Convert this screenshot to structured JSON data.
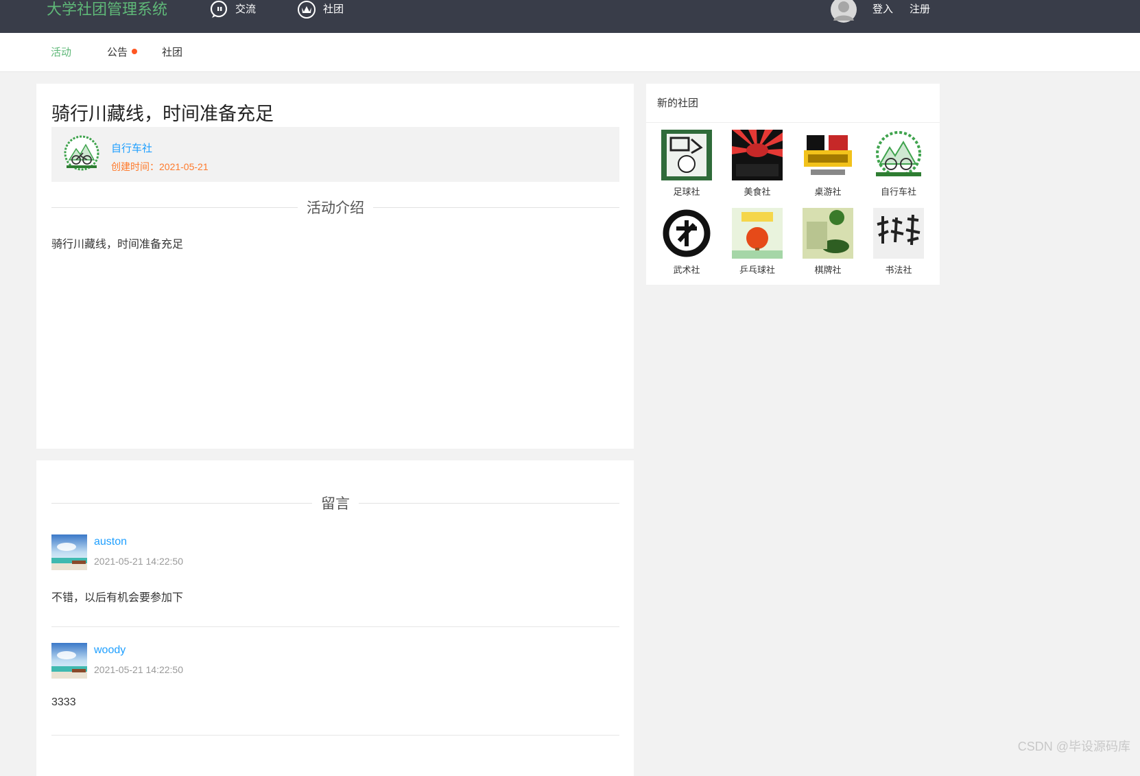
{
  "header": {
    "brand": "大学社团管理系统",
    "nav": [
      {
        "label": "交流",
        "icon": "chat-bubble-icon"
      },
      {
        "label": "社团",
        "icon": "crown-icon"
      }
    ],
    "login": "登入",
    "register": "注册"
  },
  "subnav": {
    "tabs": [
      {
        "label": "活动",
        "active": true
      },
      {
        "label": "公告",
        "has_dot": true
      },
      {
        "label": "社团"
      }
    ]
  },
  "activity": {
    "title": "骑行川藏线，时间准备充足",
    "club_name": "自行车社",
    "created": "创建时间：2021-05-21",
    "intro_heading": "活动介绍",
    "intro_text": "骑行川藏线，时间准备充足"
  },
  "comments": {
    "heading": "留言",
    "items": [
      {
        "user": "auston",
        "time": "2021-05-21 14:22:50",
        "text": "不错，以后有机会要参加下"
      },
      {
        "user": "woody",
        "time": "2021-05-21 14:22:50",
        "text": "3333"
      }
    ]
  },
  "sidebar": {
    "heading": "新的社团",
    "clubs": [
      {
        "name": "足球社"
      },
      {
        "name": "美食社"
      },
      {
        "name": "桌游社"
      },
      {
        "name": "自行车社"
      },
      {
        "name": "武术社"
      },
      {
        "name": "乒乓球社"
      },
      {
        "name": "棋牌社"
      },
      {
        "name": "书法社"
      }
    ]
  },
  "watermark": "CSDN @毕设源码库",
  "colors": {
    "header_bg": "#393d49",
    "accent_green": "#5fb878",
    "link_blue": "#1e9fff",
    "date_orange": "#ff7a2b",
    "notice_dot": "#ff5722"
  }
}
